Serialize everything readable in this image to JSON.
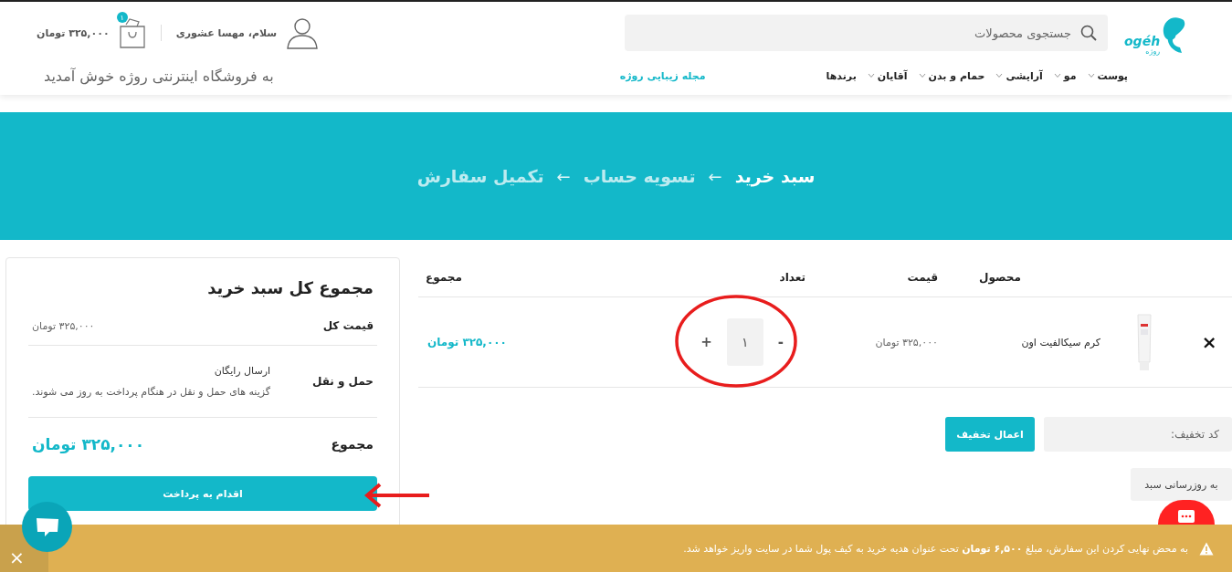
{
  "header": {
    "logo": {
      "wordmark": "ogéh",
      "subtitle": "روژه"
    },
    "search": {
      "placeholder": "جستجوی محصولات"
    },
    "user": {
      "greeting": "سلام، مهسا عشوری"
    },
    "cart": {
      "count": "۱",
      "total": "۳۲۵,۰۰۰ تومان"
    },
    "nav": [
      {
        "label": "پوست",
        "dropdown": true
      },
      {
        "label": "مو",
        "dropdown": true
      },
      {
        "label": "آرایشی",
        "dropdown": true
      },
      {
        "label": "حمام و بدن",
        "dropdown": true
      },
      {
        "label": "آقایان",
        "dropdown": true
      },
      {
        "label": "برندها",
        "dropdown": false
      }
    ],
    "magazine_link": "مجله زیبایی روژه",
    "welcome": "به فروشگاه اینترنتی روژه خوش آمدید"
  },
  "breadcrumb": {
    "steps": [
      {
        "label": "سبد خرید",
        "selected": true
      },
      {
        "label": "تسویه حساب",
        "selected": false
      },
      {
        "label": "تکمیل سفارش",
        "selected": false
      }
    ],
    "separators": [
      "←",
      "←"
    ]
  },
  "cart_table": {
    "columns": [
      "محصول",
      "قیمت",
      "تعداد",
      "مجموع"
    ],
    "rows": [
      {
        "remove": "×",
        "name": "کرم سیکالفیت اون",
        "price": "۳۲۵,۰۰۰ تومان",
        "decrement": "-",
        "quantity": "۱",
        "increment": "+",
        "subtotal": "۳۲۵,۰۰۰ تومان"
      }
    ],
    "coupon": {
      "placeholder": "کد تخفیف:",
      "button": "اعمال تخفیف"
    },
    "update_button": "به روزرسانی سبد"
  },
  "totals": {
    "title": "مجموع کل سبد خرید",
    "rows": [
      {
        "kind": "price",
        "label": "قیمت کل",
        "value": "۳۲۵,۰۰۰ تومان"
      },
      {
        "kind": "shipping",
        "label": "حمل و نقل",
        "value": "ارسال رایگان",
        "note": "گزینه های حمل و نقل در هنگام پرداخت به روز می شوند."
      },
      {
        "kind": "total",
        "label": "مجموع",
        "value": "۳۲۵,۰۰۰ تومان"
      }
    ],
    "checkout_button": "اقدام به پرداخت"
  },
  "notice": {
    "text": "به محض نهایی کردن این سفارش، مبلغ **۶,۵۰۰ تومان** تحت عنوان هدیه خرید به کیف پول شما در سایت واریز خواهد شد.",
    "close": "×"
  }
}
